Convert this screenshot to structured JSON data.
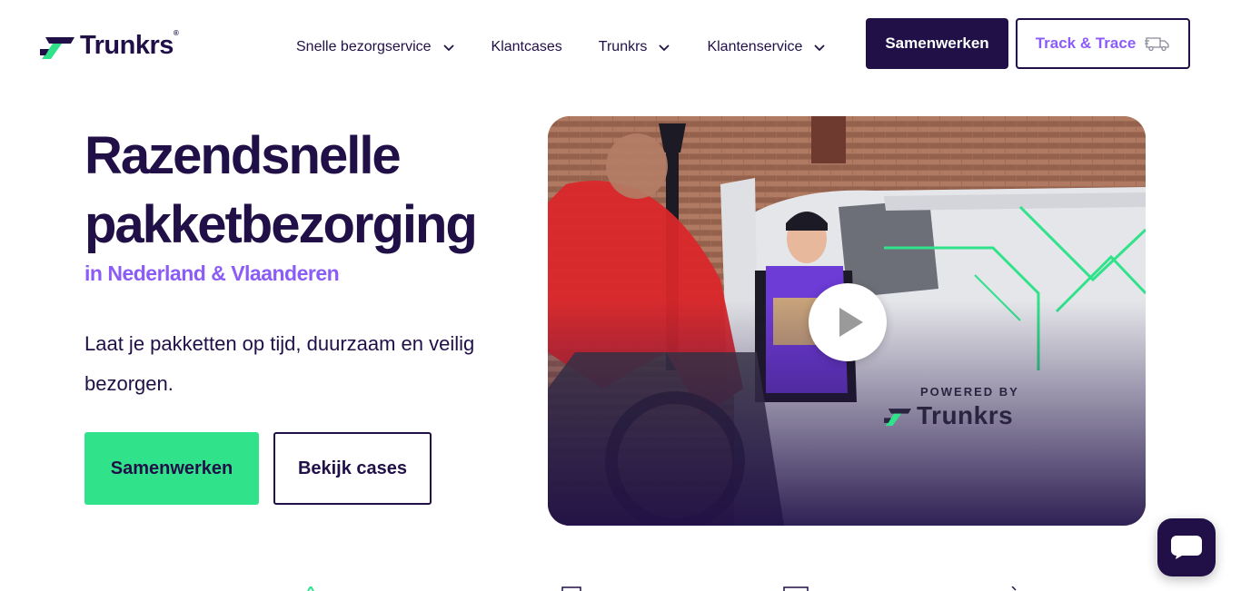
{
  "brand": {
    "name": "Trunkrs",
    "registered": "®",
    "accent_purple": "#8b5cf6",
    "navy": "#201047",
    "green": "#30e28a"
  },
  "nav": {
    "items": [
      {
        "label": "Snelle bezorgservice",
        "has_dropdown": true
      },
      {
        "label": "Klantcases",
        "has_dropdown": false
      },
      {
        "label": "Trunkrs",
        "has_dropdown": true
      },
      {
        "label": "Klantenservice",
        "has_dropdown": true
      }
    ],
    "primary_button": "Samenwerken",
    "track_button": "Track & Trace",
    "track_icon": "truck-icon"
  },
  "hero": {
    "title_line1": "Razendsnelle",
    "title_line2": "pakketbezorging",
    "subtitle": "in Nederland & Vlaanderen",
    "description": "Laat je pakketten op tijd, duurzaam en veilig bezorgen.",
    "cta_primary": "Samenwerken",
    "cta_secondary": "Bekijk cases"
  },
  "video": {
    "play_icon": "play-icon",
    "powered_by": "POWERED BY",
    "logo_text": "Trunkrs"
  },
  "chat": {
    "icon": "chat-bubble-icon"
  }
}
